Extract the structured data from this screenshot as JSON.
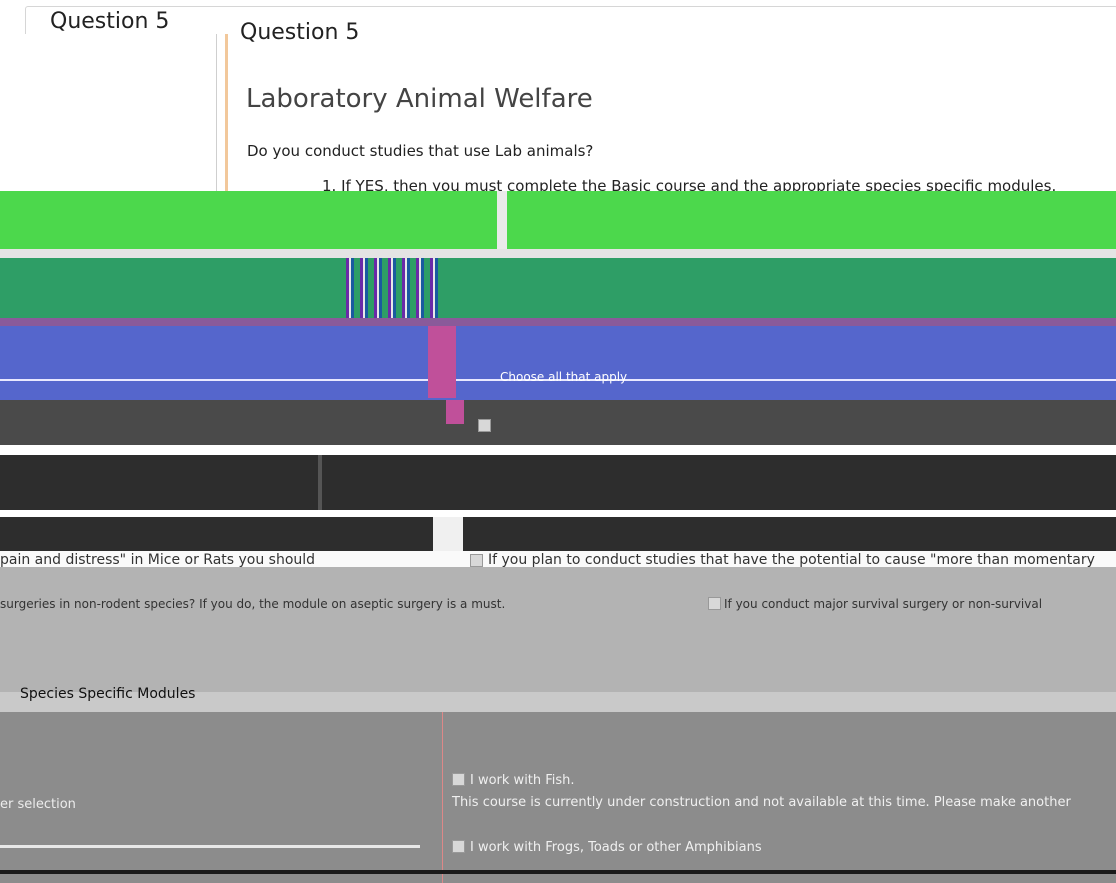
{
  "header": {
    "question_title": "Question 5",
    "question_title_repeat": "Question 5"
  },
  "section": {
    "heading": "Laboratory Animal Welfare",
    "question": "Do you conduct studies that use Lab animals?",
    "item_1": "1. If YES, then you must complete the Basic course and the appropriate species specific modules."
  },
  "options": {
    "choose_label": "Choose all that apply",
    "pain_text": "pain and distress\" in Mice or Rats you should",
    "conduct_text": "If you plan to conduct studies that have the potential to cause \"more than momentary",
    "surgery_text": "surgeries in non-rodent species? If you do, the module on aseptic surgery is a must.",
    "surgery_option": "If you conduct major survival surgery or non-survival"
  },
  "species": {
    "heading": "Species Specific Modules",
    "selection_text": "er selection",
    "fish_label": "I work with Fish.",
    "fish_note": "This course is currently under construction and not available at this time. Please make another",
    "frogs_label": "I work with Frogs, Toads or other Amphibians"
  },
  "colors": {
    "green_band": "#4cd84c",
    "teal_band": "#2e9e66",
    "blue_band": "#5566cc",
    "pink_block": "#c0509a"
  }
}
